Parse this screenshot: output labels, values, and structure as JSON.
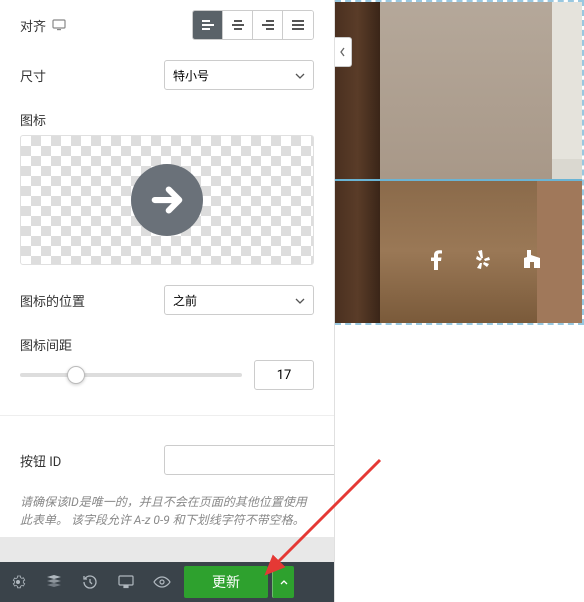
{
  "alignment": {
    "label": "对齐"
  },
  "size": {
    "label": "尺寸",
    "value": "特小号"
  },
  "icon": {
    "label": "图标"
  },
  "icon_position": {
    "label": "图标的位置",
    "value": "之前"
  },
  "icon_spacing": {
    "label": "图标间距",
    "value": "17",
    "percent": 25
  },
  "button_id": {
    "label": "按钮 ID",
    "help": "请确保该ID是唯一的，并且不会在页面的其他位置使用此表单。 该字段允许 A-z 0-9 和下划线字符不带空格。"
  },
  "footer": {
    "update_label": "更新"
  }
}
